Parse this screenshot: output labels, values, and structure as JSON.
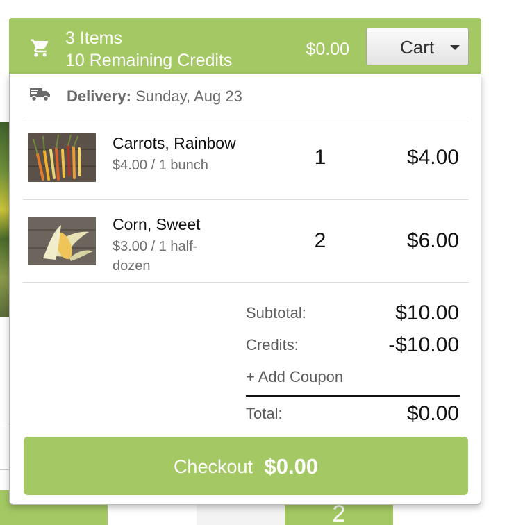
{
  "cart_header": {
    "item_count": "3 Items",
    "remaining_credits": "10 Remaining Credits",
    "total": "$0.00",
    "cart_button_label": "Cart",
    "cart_icon": "shopping-cart-icon",
    "caret_icon": "caret-down-icon"
  },
  "delivery": {
    "icon": "delivery-truck-icon",
    "label": "Delivery:",
    "date": "Sunday, Aug 23"
  },
  "items": [
    {
      "name": "Carrots, Rainbow",
      "price": "$4.00 / 1 bunch",
      "quantity": "1",
      "total": "$4.00",
      "image": "rainbow-carrots-photo"
    },
    {
      "name": "Corn, Sweet",
      "price": "$3.00 / 1 half-dozen",
      "quantity": "2",
      "total": "$6.00",
      "image": "sweet-corn-photo"
    }
  ],
  "summary": {
    "subtotal_label": "Subtotal:",
    "subtotal_value": "$10.00",
    "credits_label": "Credits:",
    "credits_value": "-$10.00",
    "add_coupon": "+ Add Coupon",
    "total_label": "Total:",
    "total_value": "$0.00"
  },
  "checkout": {
    "label": "Checkout",
    "amount": "$0.00"
  },
  "background_page": {
    "visible_number": "2"
  },
  "colors": {
    "brand_green": "#a4c864",
    "text_dark": "#111111",
    "text_muted": "#6e6e6e"
  }
}
